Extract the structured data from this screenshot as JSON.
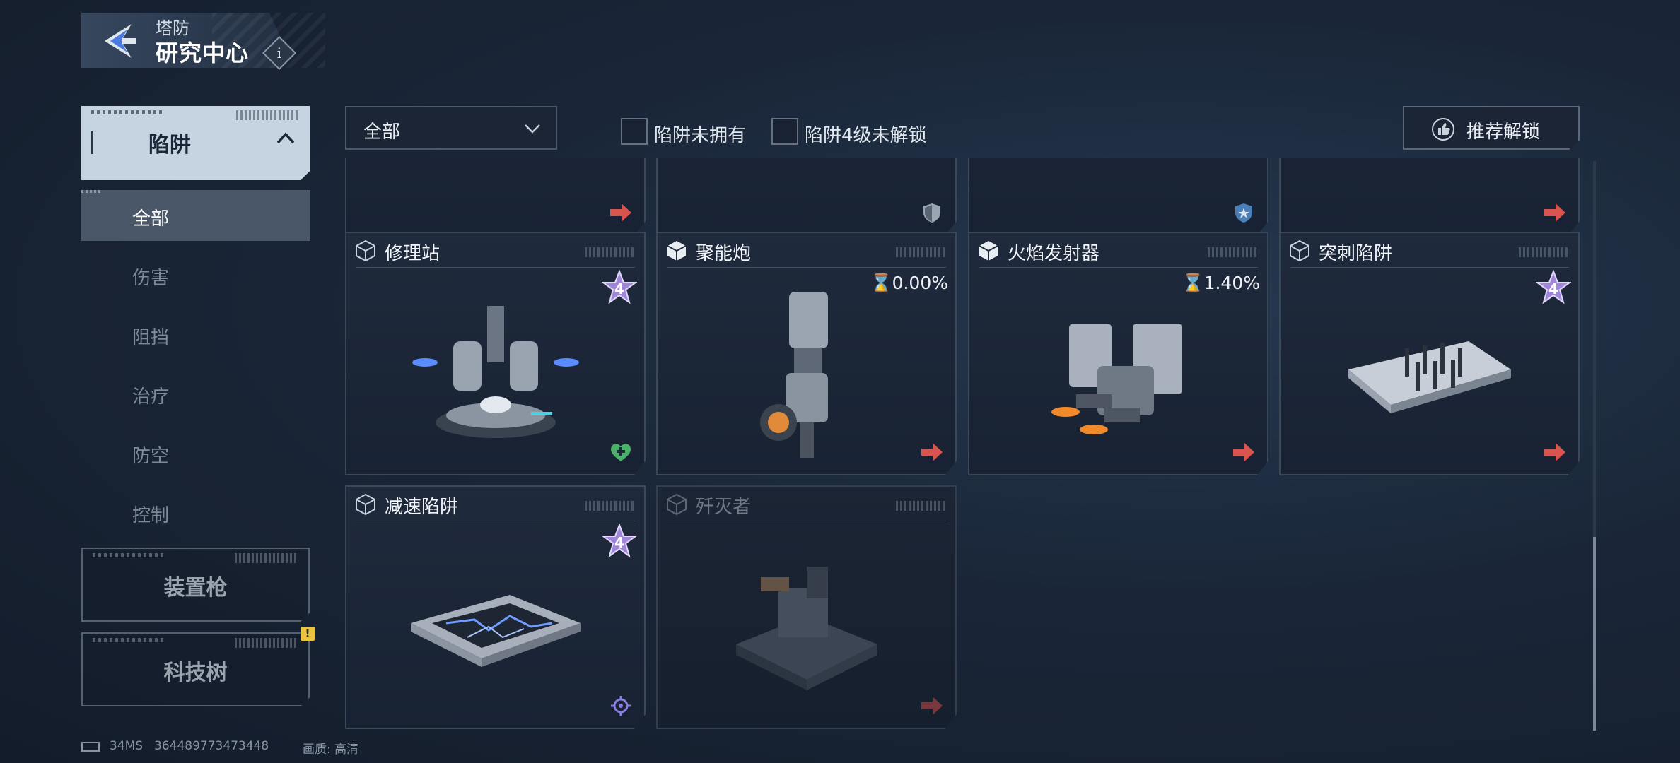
{
  "header": {
    "subtitle": "塔防",
    "title": "研究中心",
    "info_label": "i"
  },
  "sidebar": {
    "active_category": {
      "label": "陷阱"
    },
    "sub_items": [
      {
        "label": "全部",
        "active": true
      },
      {
        "label": "伤害"
      },
      {
        "label": "阻挡"
      },
      {
        "label": "治疗"
      },
      {
        "label": "防空"
      },
      {
        "label": "控制"
      }
    ],
    "categories": [
      {
        "label": "装置枪"
      },
      {
        "label": "科技树",
        "badge": "!"
      }
    ]
  },
  "filters": {
    "dropdown_value": "全部",
    "checkbox_not_owned": "陷阱未拥有",
    "checkbox_lv4_locked": "陷阱4级未解锁",
    "recommend_button": "推荐解锁"
  },
  "cards": [
    {
      "name": "",
      "corner_icon": "arrow-icon"
    },
    {
      "name": "",
      "corner_icon": "shield-icon"
    },
    {
      "name": "",
      "corner_icon": "shield-star-icon"
    },
    {
      "name": "",
      "corner_icon": "arrow-icon"
    },
    {
      "name": "修理站",
      "star_level": "4",
      "corner_icon": "heal-icon"
    },
    {
      "name": "聚能炮",
      "progress": "0.00%",
      "corner_icon": "arrow-icon"
    },
    {
      "name": "火焰发射器",
      "progress": "1.40%",
      "corner_icon": "arrow-icon"
    },
    {
      "name": "突刺陷阱",
      "star_level": "4",
      "corner_icon": "arrow-icon"
    },
    {
      "name": "减速陷阱",
      "star_level": "4",
      "corner_icon": "gear-icon"
    },
    {
      "name": "歼灭者",
      "locked": true,
      "corner_icon": "arrow-icon"
    }
  ],
  "footer": {
    "ping": "34MS",
    "uid": "364489773473448",
    "quality": "画质: 高清"
  },
  "colors": {
    "accent_red": "#d9534f",
    "star_purple": "#a88ee0",
    "heal_green": "#4caf6a",
    "badge_yellow": "#e9c43c"
  }
}
